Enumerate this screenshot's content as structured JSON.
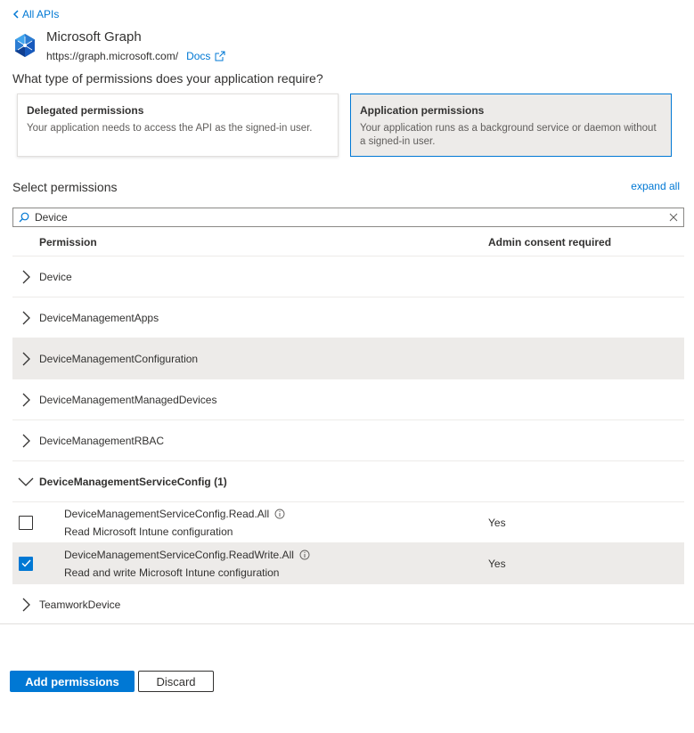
{
  "nav": {
    "back_label": "All APIs"
  },
  "api": {
    "name": "Microsoft Graph",
    "url": "https://graph.microsoft.com/",
    "docs_label": "Docs",
    "logo_icon": "microsoft-graph-logo"
  },
  "question": "What type of permissions does your application require?",
  "permission_types": [
    {
      "title": "Delegated permissions",
      "description": "Your application needs to access the API as the signed-in user.",
      "selected": false
    },
    {
      "title": "Application permissions",
      "description": "Your application runs as a background service or daemon without a signed-in user.",
      "selected": true
    }
  ],
  "select_label": "Select permissions",
  "expand_all_label": "expand all",
  "search": {
    "value": "Device",
    "placeholder": ""
  },
  "table": {
    "headers": {
      "permission": "Permission",
      "admin_consent": "Admin consent required"
    },
    "groups": [
      {
        "label": "Device"
      },
      {
        "label": "DeviceManagementApps"
      },
      {
        "label": "DeviceManagementConfiguration"
      },
      {
        "label": "DeviceManagementManagedDevices"
      },
      {
        "label": "DeviceManagementRBAC"
      },
      {
        "label": "DeviceManagementServiceConfig (1)"
      },
      {
        "label": "TeamworkDevice"
      }
    ],
    "permissions": [
      {
        "name": "DeviceManagementServiceConfig.Read.All",
        "description": "Read Microsoft Intune configuration",
        "admin_consent": "Yes",
        "checked": false
      },
      {
        "name": "DeviceManagementServiceConfig.ReadWrite.All",
        "description": "Read and write Microsoft Intune configuration",
        "admin_consent": "Yes",
        "checked": true
      }
    ]
  },
  "buttons": {
    "add": "Add permissions",
    "discard": "Discard"
  },
  "colors": {
    "accent": "#0078d4",
    "selected_bg": "#edebe9",
    "text": "#323130"
  }
}
